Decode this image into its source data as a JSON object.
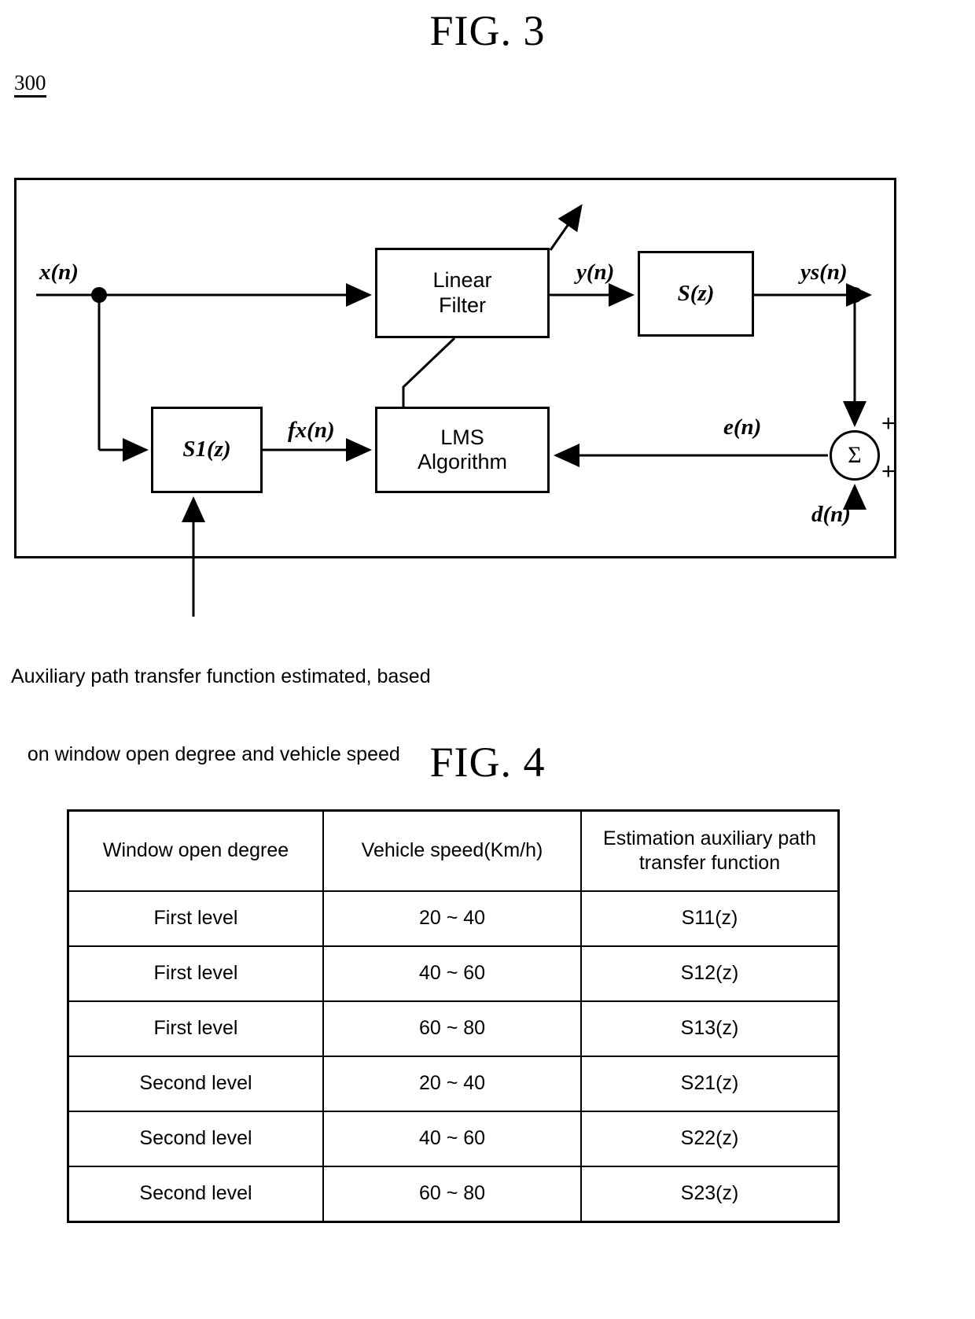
{
  "fig3": {
    "title": "FIG. 3",
    "reference_numeral": "300",
    "blocks": {
      "linear_filter": "Linear\nFilter",
      "linear_filter_line1": "Linear",
      "linear_filter_line2": "Filter",
      "sz": "S(z)",
      "s1z": "S1(z)",
      "lms_line1": "LMS",
      "lms_line2": "Algorithm"
    },
    "signals": {
      "x": "x(n)",
      "y": "y(n)",
      "ys": "ys(n)",
      "fx": "fx(n)",
      "e": "e(n)",
      "d": "d(n)",
      "sum_symbol": "Σ",
      "plus_top": "+",
      "plus_bottom": "+"
    },
    "caption_line1": "Auxiliary path transfer function estimated, based",
    "caption_line2": "   on window open degree and vehicle speed"
  },
  "fig4": {
    "title": "FIG. 4",
    "table": {
      "headers": [
        "Window open degree",
        "Vehicle speed(Km/h)",
        "Estimation auxiliary path\ntransfer function"
      ],
      "header_c_line1": "Estimation auxiliary path",
      "header_c_line2": "transfer function",
      "rows": [
        [
          "First level",
          "20 ~ 40",
          "S11(z)"
        ],
        [
          "First level",
          "40 ~ 60",
          "S12(z)"
        ],
        [
          "First level",
          "60 ~ 80",
          "S13(z)"
        ],
        [
          "Second level",
          "20 ~ 40",
          "S21(z)"
        ],
        [
          "Second level",
          "40 ~ 60",
          "S22(z)"
        ],
        [
          "Second level",
          "60 ~ 80",
          "S23(z)"
        ]
      ]
    }
  },
  "colors": {
    "ink": "#000000",
    "paper": "#ffffff"
  }
}
